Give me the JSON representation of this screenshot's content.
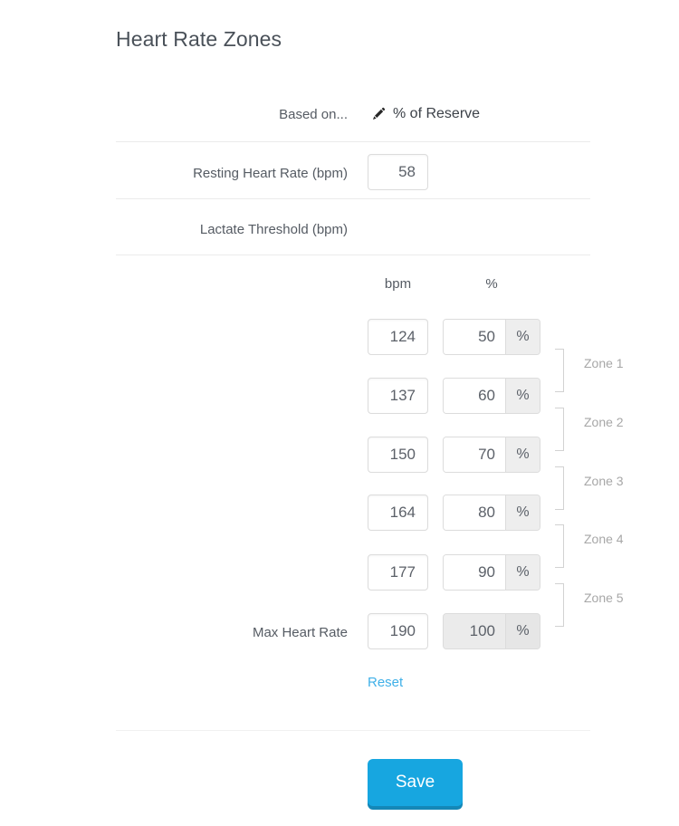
{
  "page": {
    "title": "Heart Rate Zones"
  },
  "based_on": {
    "label": "Based on...",
    "value": "% of Reserve",
    "icon": "pencil-icon"
  },
  "fields": {
    "resting": {
      "label": "Resting Heart Rate (bpm)",
      "value": "58"
    },
    "lactate": {
      "label": "Lactate Threshold (bpm)",
      "value": ""
    },
    "max": {
      "label": "Max Heart Rate"
    }
  },
  "columns": {
    "bpm": "bpm",
    "percent": "%"
  },
  "percent_symbol": "%",
  "rows": [
    {
      "bpm": "124",
      "percent": "50",
      "disabled": false
    },
    {
      "bpm": "137",
      "percent": "60",
      "disabled": false
    },
    {
      "bpm": "150",
      "percent": "70",
      "disabled": false
    },
    {
      "bpm": "164",
      "percent": "80",
      "disabled": false
    },
    {
      "bpm": "177",
      "percent": "90",
      "disabled": false
    },
    {
      "bpm": "190",
      "percent": "100",
      "disabled": true
    }
  ],
  "zones": [
    {
      "label": "Zone 1"
    },
    {
      "label": "Zone 2"
    },
    {
      "label": "Zone 3"
    },
    {
      "label": "Zone 4"
    },
    {
      "label": "Zone 5"
    }
  ],
  "actions": {
    "reset": "Reset",
    "save": "Save"
  },
  "colors": {
    "accent": "#17a6e0",
    "accent_shadow": "#1487b7",
    "link": "#3fb0e8",
    "text": "#555b63",
    "muted": "#a7a7a7",
    "border": "#dcdcdc",
    "divider": "#ebebeb",
    "addon_bg": "#eeeeee",
    "disabled_bg": "#ebebeb"
  }
}
